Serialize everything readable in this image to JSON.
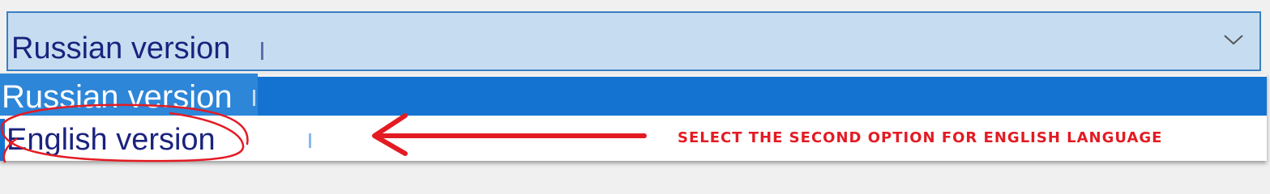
{
  "select": {
    "value": "Russian version",
    "chevron_icon": "chevron-down-icon"
  },
  "options": [
    {
      "label": "Russian version",
      "selected": true
    },
    {
      "label": "English version",
      "selected": false
    }
  ],
  "annotation": {
    "text": "SELECT THE SECOND OPTION FOR ENGLISH LANGUAGE",
    "color": "#e31b23"
  },
  "colors": {
    "select_bg": "#c6ddf1",
    "select_border": "#3b7fc4",
    "option_selected_bg": "#1473d1",
    "text_dark": "#1a237e"
  }
}
